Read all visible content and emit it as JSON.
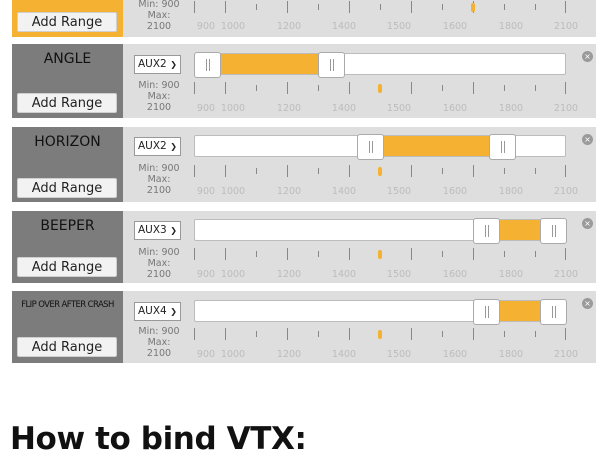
{
  "add_range_label": "Add Range",
  "tick_labels": [
    "900",
    "1000",
    "1200",
    "1400",
    "1500",
    "1600",
    "1800",
    "2100"
  ],
  "remove_icon_label": "×",
  "colors": {
    "accent": "#f5b131",
    "label_bg": "#7c7c7c",
    "range_bg": "#dedede"
  },
  "modes": [
    {
      "name": "",
      "channel": "",
      "min_label": "Min: 900",
      "max_label": "Max: 2100",
      "range": [],
      "channel_value": 1800,
      "partial_top": true
    },
    {
      "name": "ANGLE",
      "channel": "AUX2",
      "min_label": "Min: 900",
      "max_label": "Max: 2100",
      "range": [
        900,
        1300
      ],
      "channel_value": 1500
    },
    {
      "name": "HORIZON",
      "channel": "AUX2",
      "min_label": "Min: 900",
      "max_label": "Max: 2100",
      "range": [
        1425,
        1850
      ],
      "channel_value": 1500
    },
    {
      "name": "BEEPER",
      "channel": "AUX3",
      "min_label": "Min: 900",
      "max_label": "Max: 2100",
      "range": [
        1800,
        2100
      ],
      "channel_value": 1500
    },
    {
      "name": "FLIP OVER AFTER CRASH",
      "channel": "AUX4",
      "min_label": "Min: 900",
      "max_label": "Max: 2100",
      "range": [
        1800,
        2100
      ],
      "channel_value": 1500
    }
  ],
  "heading": "How to bind VTX:"
}
